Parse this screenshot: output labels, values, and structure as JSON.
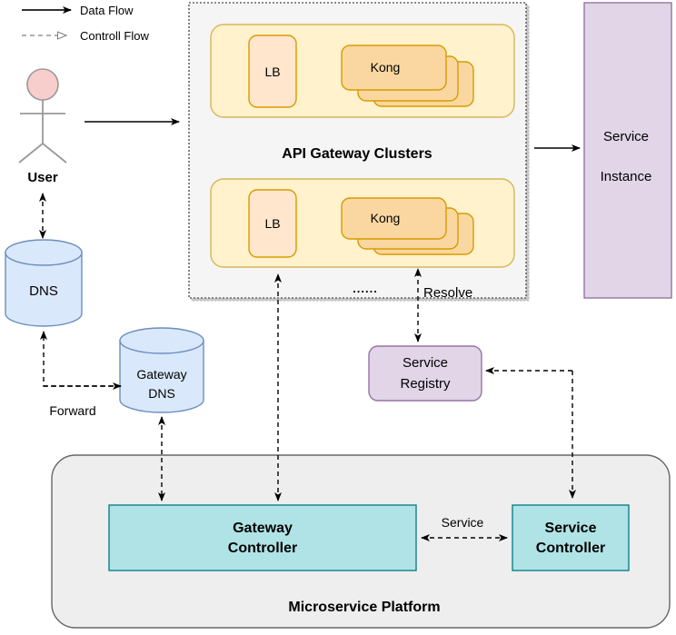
{
  "legend": {
    "items": [
      {
        "label": "Data Flow",
        "style": "solid",
        "arrow": "filled"
      },
      {
        "label": "Controll Flow",
        "style": "dashed",
        "arrow": "hollow"
      }
    ]
  },
  "actors": {
    "user": {
      "label": "User",
      "head_color": "#f8cecc",
      "stroke": "#999999"
    }
  },
  "nodes": {
    "dns": {
      "label": "DNS",
      "fill": "#dae8fc",
      "stroke": "#6c8ebf",
      "shape": "cylinder"
    },
    "gateway_dns": {
      "label_line1": "Gateway",
      "label_line2": "DNS",
      "fill": "#dae8fc",
      "stroke": "#6c8ebf",
      "shape": "cylinder"
    },
    "api_gateway_container": {
      "label": "API Gateway Clusters",
      "fill": "#f5f5f5",
      "stroke": "#666666",
      "border": "dotted"
    },
    "cluster_1": {
      "fill": "#fff2cc",
      "stroke": "#d6b656",
      "lb_label": "LB",
      "kong_label": "Kong"
    },
    "cluster_2": {
      "fill": "#fff2cc",
      "stroke": "#d6b656",
      "lb_label": "LB",
      "kong_label": "Kong"
    },
    "lb": {
      "label": "LB",
      "fill": "#ffe6cc",
      "stroke": "#d79b00"
    },
    "kong": {
      "label": "Kong",
      "fill": "#fad7a0",
      "stroke": "#d79b00",
      "stack_count": 3
    },
    "ellipsis": {
      "label": "......"
    },
    "service_instance": {
      "label_line1": "Service",
      "label_line2": "Instance",
      "fill": "#e1d5e7",
      "stroke": "#9673a6"
    },
    "service_registry": {
      "label_line1": "Service",
      "label_line2": "Registry",
      "fill": "#e1d5e7",
      "stroke": "#9673a6"
    },
    "microservice_platform": {
      "label": "Microservice Platform",
      "fill": "#eeeeee",
      "stroke": "#666666"
    },
    "gateway_controller": {
      "label_line1": "Gateway",
      "label_line2": "Controller",
      "fill": "#b0e3e6",
      "stroke": "#0e8088"
    },
    "service_controller": {
      "label_line1": "Service",
      "label_line2": "Controller",
      "fill": "#b0e3e6",
      "stroke": "#0e8088"
    }
  },
  "edge_labels": {
    "forward": "Forward",
    "resolve": "Resolve",
    "service": "Service"
  }
}
